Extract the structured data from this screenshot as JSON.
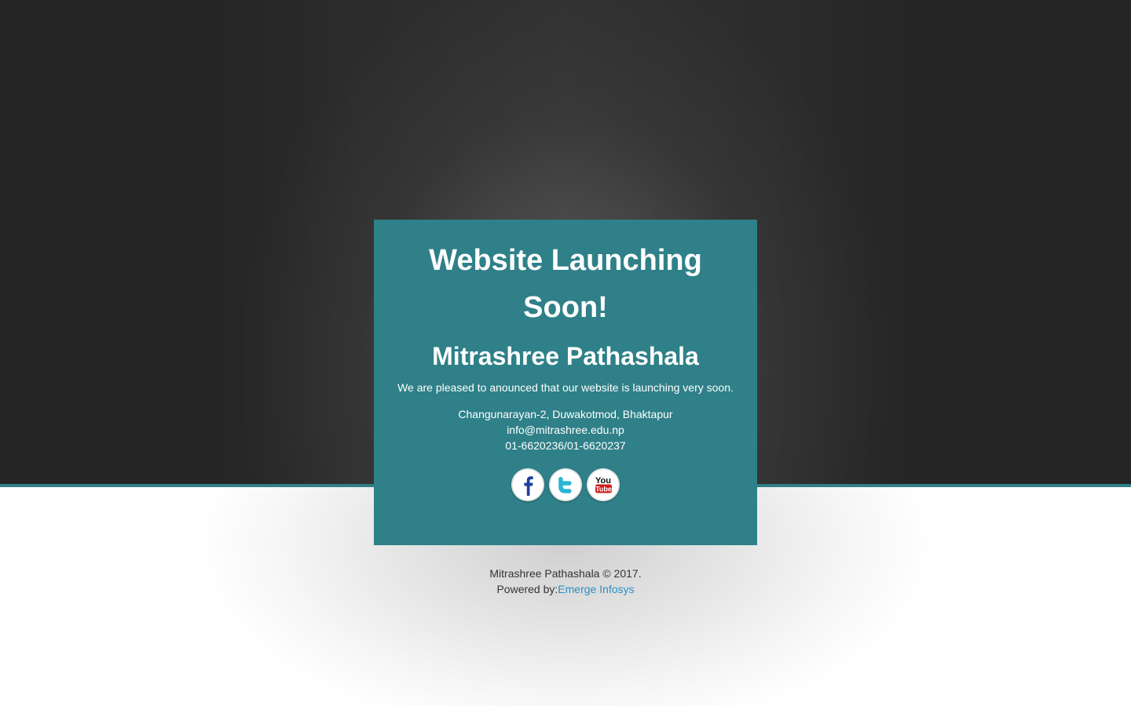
{
  "hero": {
    "title": "Website Launching Soon!",
    "school_name": "Mitrashree Pathashala",
    "tagline": "We are pleased to anounced that our website is launching very soon."
  },
  "contact": {
    "address": "Changunarayan-2, Duwakotmod, Bhaktapur",
    "email": "info@mitrashree.edu.np",
    "phone": "01-6620236/01-6620237"
  },
  "social": [
    {
      "name": "facebook-icon"
    },
    {
      "name": "twitter-icon"
    },
    {
      "name": "youtube-icon",
      "text_top": "You",
      "text_bottom": "Tube"
    }
  ],
  "footer": {
    "copyright": "Mitrashree Pathashala © 2017.",
    "powered_prefix": "Powered by:",
    "powered_link": "Emerge Infosys"
  },
  "colors": {
    "card": "#2f8088",
    "link": "#2a8fc9"
  }
}
